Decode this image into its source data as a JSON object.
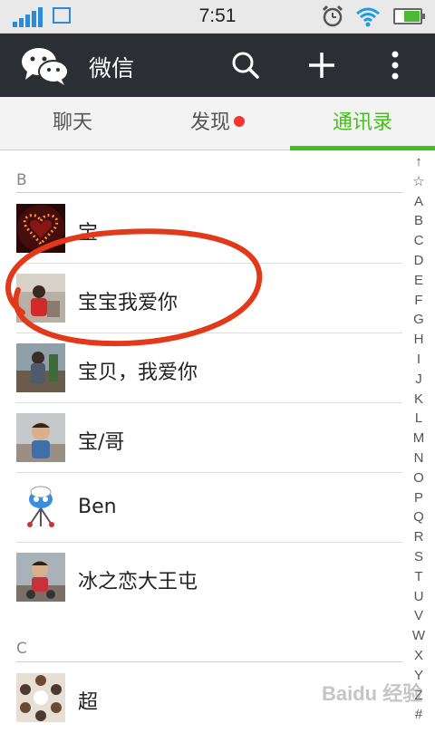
{
  "status_bar": {
    "time": "7:51",
    "icons": [
      "signal-icon",
      "image-icon",
      "alarm-icon",
      "wifi-icon",
      "battery-icon"
    ]
  },
  "app_bar": {
    "title": "微信",
    "actions": [
      "search-icon",
      "plus-icon",
      "more-icon"
    ]
  },
  "tabs": [
    {
      "label": "聊天"
    },
    {
      "label": "发现",
      "badge": "red-dot"
    },
    {
      "label": "通讯录",
      "active": true
    }
  ],
  "contacts": {
    "section_b": "B",
    "section_c": "C",
    "b_items": [
      {
        "name": "宝"
      },
      {
        "name": "宝宝我爱你"
      },
      {
        "name": "宝贝，我爱你"
      },
      {
        "name": "宝/哥"
      },
      {
        "name": "Ben"
      },
      {
        "name": "冰之恋大王屯"
      }
    ],
    "c_items": [
      {
        "name": "超"
      }
    ]
  },
  "index_letters": [
    "↑",
    "☆",
    "A",
    "B",
    "C",
    "D",
    "E",
    "F",
    "G",
    "H",
    "I",
    "J",
    "K",
    "L",
    "M",
    "N",
    "O",
    "P",
    "Q",
    "R",
    "S",
    "T",
    "U",
    "V",
    "W",
    "X",
    "Y",
    "Z",
    "#"
  ],
  "watermark": "Baidu 经验",
  "colors": {
    "accent": "#45c01a",
    "app_bar": "#2b2e33",
    "badge": "#f43530",
    "annotation": "#e2391b"
  }
}
